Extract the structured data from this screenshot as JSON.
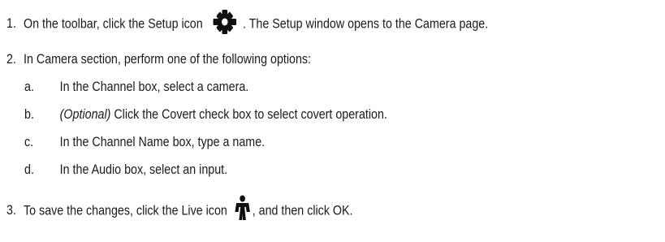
{
  "steps": [
    {
      "number": "1.",
      "text_before_icon": "On the toolbar, click the Setup icon",
      "icon": "gear-icon",
      "text_after_icon": ". The Setup window opens to the Camera page."
    },
    {
      "number": "2.",
      "text": "In Camera section, perform one of the following options:",
      "substeps": [
        {
          "letter": "a.",
          "text": "In the Channel box, select a camera."
        },
        {
          "letter": "b.",
          "italic_prefix": "(Optional)",
          "text": " Click the Covert check box to select covert operation."
        },
        {
          "letter": "c.",
          "text": "In the Channel Name box, type a name."
        },
        {
          "letter": "d.",
          "text": "In the Audio box, select an input."
        }
      ]
    },
    {
      "number": "3.",
      "text_before_icon": "To save the changes, click the Live icon",
      "icon": "person-icon",
      "text_after_icon": ", and then click OK."
    }
  ]
}
